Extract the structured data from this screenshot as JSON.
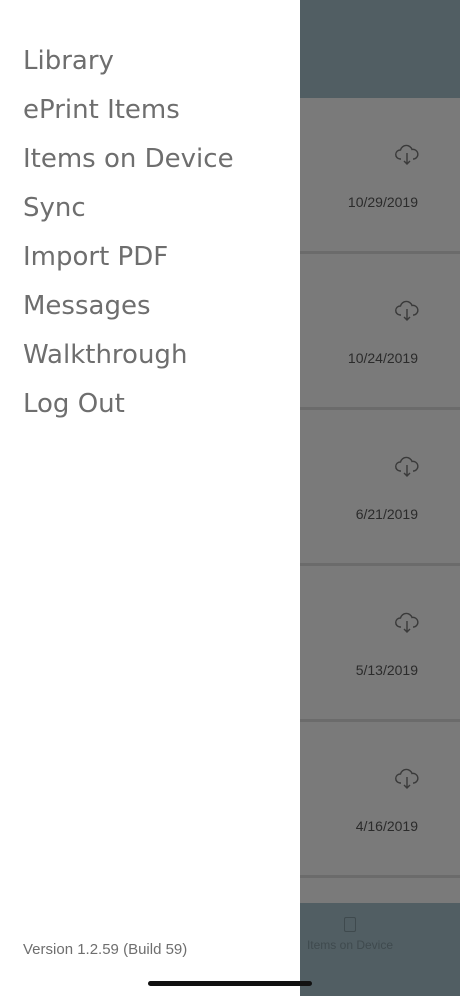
{
  "menu": {
    "items": [
      {
        "label": "Library"
      },
      {
        "label": "ePrint Items"
      },
      {
        "label": "Items on Device"
      },
      {
        "label": "Sync"
      },
      {
        "label": "Import PDF"
      },
      {
        "label": "Messages"
      },
      {
        "label": "Walkthrough"
      },
      {
        "label": "Log Out"
      }
    ]
  },
  "version_text": "Version 1.2.59 (Build 59)",
  "background": {
    "rows": [
      {
        "date": "10/29/2019",
        "icon": "cloud-download-icon"
      },
      {
        "date": "10/24/2019",
        "icon": "cloud-download-icon"
      },
      {
        "date": "6/21/2019",
        "icon": "cloud-download-icon"
      },
      {
        "date": "5/13/2019",
        "icon": "cloud-download-icon"
      },
      {
        "date": "4/16/2019",
        "icon": "cloud-download-icon"
      }
    ],
    "tab_label": "Items on Device"
  },
  "colors": {
    "header": "#515e63",
    "overlay": "#757575",
    "menu_text": "#6e6e6e"
  }
}
